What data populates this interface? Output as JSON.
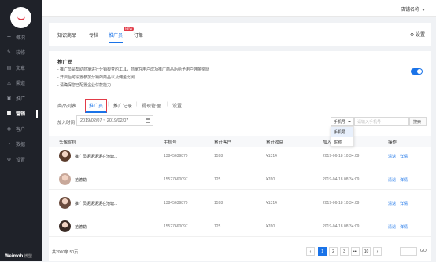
{
  "brand": {
    "name": "Weimob",
    "sub": "微盟"
  },
  "sidebar": {
    "items": [
      {
        "label": "概况",
        "icon": "menu-lines-icon",
        "glyph": "☰",
        "active": false
      },
      {
        "label": "装修",
        "icon": "paint-icon",
        "glyph": "✎",
        "active": false
      },
      {
        "label": "文章",
        "icon": "document-icon",
        "glyph": "▤",
        "active": false
      },
      {
        "label": "渠道",
        "icon": "channel-icon",
        "glyph": "◬",
        "active": false
      },
      {
        "label": "推广",
        "icon": "promote-icon",
        "glyph": "▣",
        "active": false
      },
      {
        "label": "营销",
        "icon": "marketing-icon",
        "glyph": "▦",
        "active": true
      },
      {
        "label": "客户",
        "icon": "customer-icon",
        "glyph": "◉",
        "active": false
      },
      {
        "label": "数据",
        "icon": "data-icon",
        "glyph": "◔",
        "active": false
      },
      {
        "label": "设置",
        "icon": "gear-icon",
        "glyph": "⚙",
        "active": false
      }
    ]
  },
  "header": {
    "store": "店铺名称"
  },
  "tabs": {
    "items": [
      "知识商品",
      "专栏",
      "推广员",
      "订单"
    ],
    "active": 2,
    "new_badge": "NEW",
    "settings": "设置"
  },
  "panel": {
    "title": "推广员",
    "lines": [
      "- 推广员是帮助商家进行分销裂变的工具，商家在用户成功推广商品后给予用户佣金奖励",
      "- 开启后可设置参加分销的商品以及佣金比例",
      "- 请确保您已配置企业付款能力"
    ],
    "toggle_on": true
  },
  "subtabs": {
    "items": [
      "商品列表",
      "推广员",
      "推广记录",
      "提现管理",
      "设置"
    ],
    "active": 1
  },
  "filter": {
    "label": "加入时间",
    "date_range": "2019/02/07 ~ 2019/02/07",
    "select_value": "手机号",
    "search_placeholder": "请输入手机号",
    "search_button": "搜索",
    "dropdown": [
      "手机号",
      "昵称"
    ]
  },
  "table": {
    "columns": [
      "头像昵称",
      "手机号",
      "累计客户",
      "累计收益",
      "加入时间",
      "操作"
    ],
    "rows": [
      {
        "name": "推广员泥泥泥泥在池塘...",
        "phone": "13845639879",
        "customers": "1598",
        "income": "¥1314",
        "time": "2019-06-18 10:34:09",
        "avatar_color": "#5b3b2b"
      },
      {
        "name": "范德勒",
        "phone": "15527660097",
        "customers": "125",
        "income": "¥760",
        "time": "2019-04-18 08:34:09",
        "avatar_color": "#c8a89a"
      },
      {
        "name": "推广员泥泥泥泥在池塘...",
        "phone": "13845639879",
        "customers": "1598",
        "income": "¥1314",
        "time": "2019-06-18 10:34:09",
        "avatar_color": "#6b4c3e"
      },
      {
        "name": "范德勒",
        "phone": "15527660097",
        "customers": "125",
        "income": "¥760",
        "time": "2019-04-18 08:34:09",
        "avatar_color": "#3a2a24"
      }
    ],
    "actions": [
      "清退",
      "详情"
    ]
  },
  "pagination": {
    "total": "共2000条 50页",
    "pages": [
      "‹",
      "1",
      "2",
      "3",
      "•••",
      "10",
      "›"
    ],
    "active": "1",
    "go": "GO"
  }
}
